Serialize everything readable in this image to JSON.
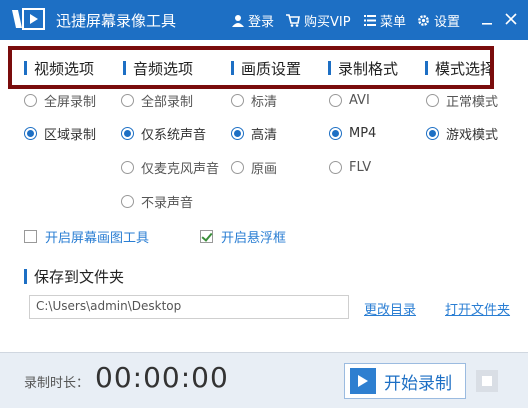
{
  "app": {
    "title": "迅捷屏幕录像工具",
    "accent_color": "#1d6fc4",
    "highlight_border_color": "#7a0c0c"
  },
  "titlebar": {
    "login_label": "登录",
    "vip_label": "购买VIP",
    "menu_label": "菜单",
    "settings_label": "设置",
    "icons": [
      "user-icon",
      "cart-icon",
      "menu-icon",
      "gear-icon",
      "minimize-icon",
      "close-icon"
    ]
  },
  "tabs": [
    {
      "label": "视频选项"
    },
    {
      "label": "音频选项"
    },
    {
      "label": "画质设置"
    },
    {
      "label": "录制格式"
    },
    {
      "label": "模式选择"
    }
  ],
  "video_options": [
    {
      "label": "全屏录制",
      "selected": false
    },
    {
      "label": "区域录制",
      "selected": true
    }
  ],
  "audio_options": [
    {
      "label": "全部录制",
      "selected": false
    },
    {
      "label": "仅系统声音",
      "selected": true
    },
    {
      "label": "仅麦克风声音",
      "selected": false
    },
    {
      "label": "不录声音",
      "selected": false
    }
  ],
  "quality_options": [
    {
      "label": "标清",
      "selected": false
    },
    {
      "label": "高清",
      "selected": true
    },
    {
      "label": "原画",
      "selected": false
    }
  ],
  "format_options": [
    {
      "label": "AVI",
      "selected": false
    },
    {
      "label": "MP4",
      "selected": true
    },
    {
      "label": "FLV",
      "selected": false
    }
  ],
  "mode_options": [
    {
      "label": "正常模式",
      "selected": false
    },
    {
      "label": "游戏模式",
      "selected": true
    }
  ],
  "toggles": {
    "draw_tool_label": "开启屏幕画图工具",
    "draw_tool_checked": false,
    "float_window_label": "开启悬浮框",
    "float_window_checked": true
  },
  "save": {
    "title": "保存到文件夹",
    "path": "C:\\Users\\admin\\Desktop",
    "change_dir_label": "更改目录",
    "open_folder_label": "打开文件夹"
  },
  "footer": {
    "duration_label": "录制时长：",
    "duration_value": "00:00:00",
    "record_label": "开始录制"
  }
}
